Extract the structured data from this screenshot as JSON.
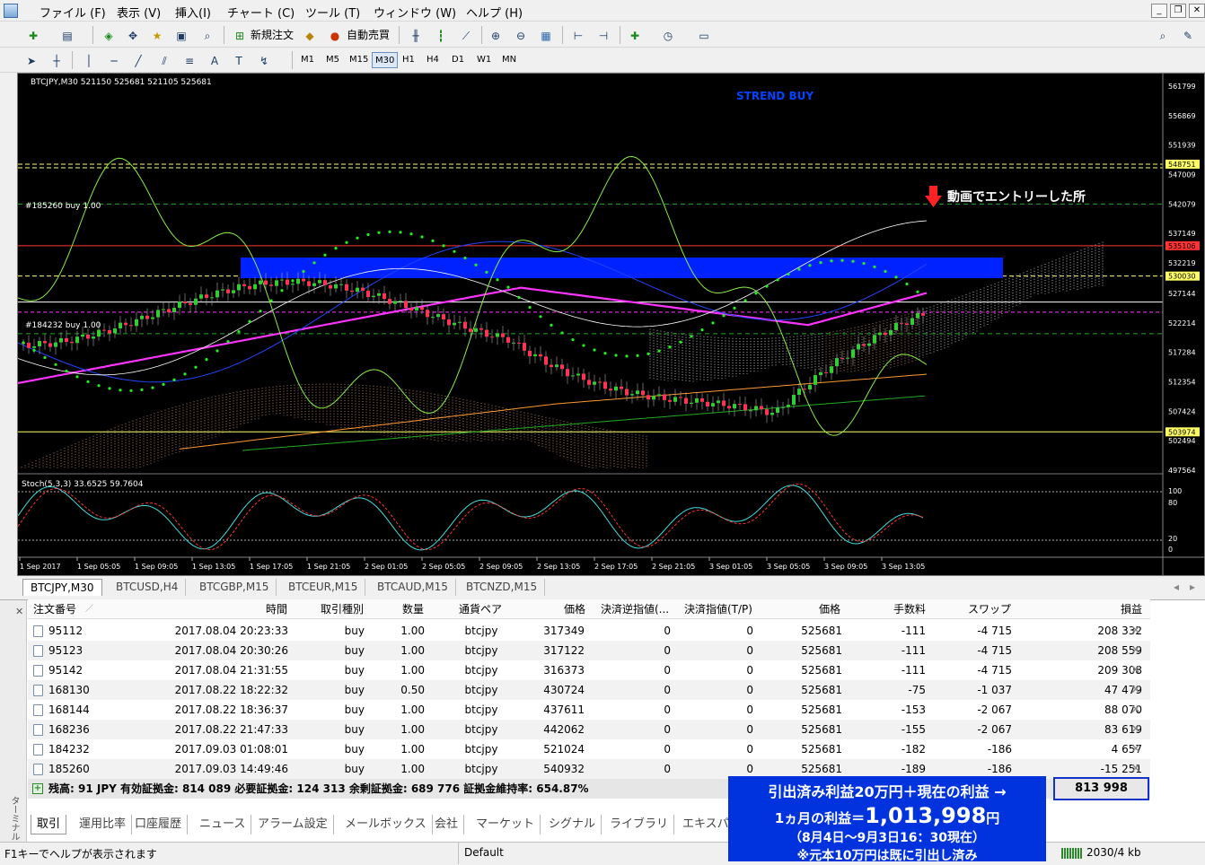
{
  "menu": {
    "items": [
      "ファイル (F)",
      "表示 (V)",
      "挿入(I)",
      "チャート (C)",
      "ツール (T)",
      "ウィンドウ (W)",
      "ヘルプ (H)"
    ]
  },
  "toolbar": {
    "new_order_label": "新規注文",
    "auto_trade_label": "自動売買",
    "timeframes": [
      "M1",
      "M5",
      "M15",
      "M30",
      "H1",
      "H4",
      "D1",
      "W1",
      "MN"
    ],
    "active_timeframe": "M30"
  },
  "chart": {
    "header": "BTCJPY,M30  521150 525681 521105 525681",
    "signal_text": "STREND BUY",
    "annotation": "動画でエントリーした所",
    "order_labels": [
      "#185260 buy 1.00",
      "#184232 buy 1.00"
    ],
    "price_labels": [
      "561799",
      "556869",
      "551939",
      "548751",
      "547009",
      "542079",
      "537149",
      "535106",
      "532219",
      "530030",
      "527144",
      "522214",
      "517284",
      "512354",
      "507424",
      "503974",
      "502494",
      "497564"
    ],
    "stoch_label": "Stoch(5,3,3) 33.6525 59.7604",
    "stoch_levels": [
      "100",
      "80",
      "20",
      "0"
    ],
    "time_labels": [
      "1 Sep 2017",
      "1 Sep 05:05",
      "1 Sep 09:05",
      "1 Sep 13:05",
      "1 Sep 17:05",
      "1 Sep 21:05",
      "2 Sep 01:05",
      "2 Sep 05:05",
      "2 Sep 09:05",
      "2 Sep 13:05",
      "2 Sep 17:05",
      "2 Sep 21:05",
      "3 Sep 01:05",
      "3 Sep 05:05",
      "3 Sep 09:05",
      "3 Sep 13:05"
    ],
    "colors": {
      "background": "#000000",
      "bull": "#33cc33",
      "bear": "#ff3355",
      "ma": "#ff33ff",
      "rect": "#0022ff",
      "psar": "#22ee22",
      "text": "#ffffff"
    }
  },
  "chart_tabs": [
    "BTCJPY,M30",
    "BTCUSD,H4",
    "BTCGBP,M15",
    "BTCEUR,M15",
    "BTCAUD,M15",
    "BTCNZD,M15"
  ],
  "terminal": {
    "side_label": "ターミナル",
    "columns": [
      "注文番号",
      "時間",
      "取引種別",
      "数量",
      "通貨ペア",
      "価格",
      "決済逆指値(...",
      "決済指値(T/P)",
      "価格",
      "手数料",
      "スワップ",
      "損益"
    ],
    "rows": [
      {
        "id": "95112",
        "time": "2017.08.04 20:23:33",
        "type": "buy",
        "size": "1.00",
        "symbol": "btcjpy",
        "price": "317349",
        "sl": "0",
        "tp": "0",
        "cur": "525681",
        "fee": "-111",
        "swap": "-4 715",
        "profit": "208 332"
      },
      {
        "id": "95123",
        "time": "2017.08.04 20:30:26",
        "type": "buy",
        "size": "1.00",
        "symbol": "btcjpy",
        "price": "317122",
        "sl": "0",
        "tp": "0",
        "cur": "525681",
        "fee": "-111",
        "swap": "-4 715",
        "profit": "208 559"
      },
      {
        "id": "95142",
        "time": "2017.08.04 21:31:55",
        "type": "buy",
        "size": "1.00",
        "symbol": "btcjpy",
        "price": "316373",
        "sl": "0",
        "tp": "0",
        "cur": "525681",
        "fee": "-111",
        "swap": "-4 715",
        "profit": "209 308"
      },
      {
        "id": "168130",
        "time": "2017.08.22 18:22:32",
        "type": "buy",
        "size": "0.50",
        "symbol": "btcjpy",
        "price": "430724",
        "sl": "0",
        "tp": "0",
        "cur": "525681",
        "fee": "-75",
        "swap": "-1 037",
        "profit": "47 479"
      },
      {
        "id": "168144",
        "time": "2017.08.22 18:36:37",
        "type": "buy",
        "size": "1.00",
        "symbol": "btcjpy",
        "price": "437611",
        "sl": "0",
        "tp": "0",
        "cur": "525681",
        "fee": "-153",
        "swap": "-2 067",
        "profit": "88 070"
      },
      {
        "id": "168236",
        "time": "2017.08.22 21:47:33",
        "type": "buy",
        "size": "1.00",
        "symbol": "btcjpy",
        "price": "442062",
        "sl": "0",
        "tp": "0",
        "cur": "525681",
        "fee": "-155",
        "swap": "-2 067",
        "profit": "83 619"
      },
      {
        "id": "184232",
        "time": "2017.09.03 01:08:01",
        "type": "buy",
        "size": "1.00",
        "symbol": "btcjpy",
        "price": "521024",
        "sl": "0",
        "tp": "0",
        "cur": "525681",
        "fee": "-182",
        "swap": "-186",
        "profit": "4 657"
      },
      {
        "id": "185260",
        "time": "2017.09.03 14:49:46",
        "type": "buy",
        "size": "1.00",
        "symbol": "btcjpy",
        "price": "540932",
        "sl": "0",
        "tp": "0",
        "cur": "525681",
        "fee": "-189",
        "swap": "-186",
        "profit": "-15 251"
      }
    ],
    "balance": "残高: 91 JPY  有効証拠金: 814 089  必要証拠金: 124 313  余剰証拠金: 689 776  証拠金維持率: 654.87%",
    "total_profit": "813 998",
    "tabs": [
      "取引",
      "運用比率",
      "口座履歴",
      "ニュース",
      "アラーム設定",
      "メールボックス",
      "会社",
      "マーケット",
      "シグナル",
      "ライブラリ",
      "エキスパ"
    ]
  },
  "overlay": {
    "line1": "引出済み利益20万円＋現在の利益 →",
    "line2_prefix": "1ヵ月の利益＝",
    "line2_amount": "1,013,998",
    "line2_suffix": "円",
    "line3": "（8月4日～9月3日16：30現在）",
    "line4": "※元本10万円は既に引出し済み"
  },
  "status": {
    "help": "F1キーでヘルプが表示されます",
    "profile": "Default",
    "traffic": "2030/4 kb"
  }
}
